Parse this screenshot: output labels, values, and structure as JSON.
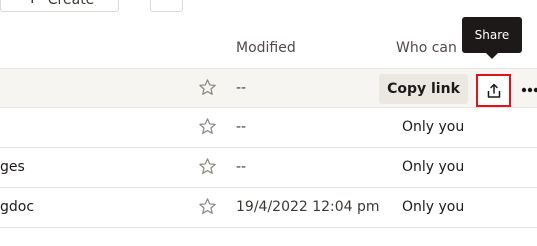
{
  "toolbar": {
    "create_label": "Create",
    "create_icon": "plus-icon"
  },
  "table": {
    "columns": {
      "modified": "Modified",
      "who": "Who can a"
    },
    "rows": [
      {
        "name": "",
        "starred": false,
        "modified": "--",
        "who": ""
      },
      {
        "name": "",
        "starred": false,
        "modified": "--",
        "who": "Only you"
      },
      {
        "name": "ges",
        "starred": false,
        "modified": "--",
        "who": "Only you"
      },
      {
        "name": "gdoc",
        "starred": false,
        "modified": "19/4/2022 12:04 pm",
        "who": "Only you"
      }
    ]
  },
  "row_actions": {
    "copy_link_label": "Copy link",
    "share_icon": "share-icon",
    "more_icon": "more-horizontal-icon"
  },
  "tooltip": {
    "text": "Share"
  },
  "colors": {
    "highlight_border": "#e3111b",
    "hover_row": "#f7f5f2",
    "copy_button_bg": "#ebe7e1",
    "tooltip_bg": "#1e1919"
  }
}
